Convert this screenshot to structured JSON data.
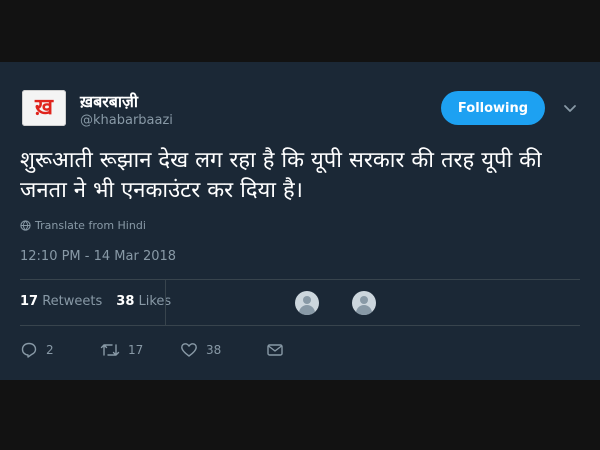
{
  "profile": {
    "name": "ख़बरबाज़ी",
    "handle": "@khabarbaazi",
    "avatar_text": "ख़"
  },
  "follow_button": {
    "label": "Following"
  },
  "tweet": {
    "text": "शुरूआती रूझान देख लग रहा है कि यूपी सरकार की तरह यूपी की जनता ने भी एनकाउंटर कर दिया है।",
    "translate_label": "Translate from Hindi",
    "timestamp": "12:10 PM - 14 Mar 2018"
  },
  "stats": {
    "retweets_count": "17",
    "retweets_label": "Retweets",
    "likes_count": "38",
    "likes_label": "Likes"
  },
  "actions": {
    "reply_count": "2",
    "retweet_count": "17",
    "like_count": "38"
  },
  "colors": {
    "accent": "#1da1f2",
    "card_bg": "#1b2836",
    "muted": "#8899a6"
  }
}
